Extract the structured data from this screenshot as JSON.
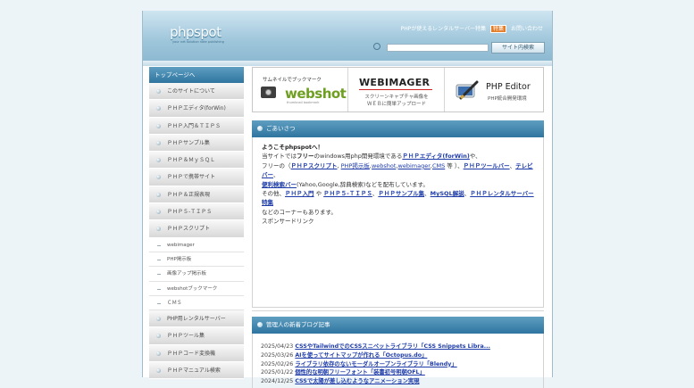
{
  "header": {
    "logo": "phpspot",
    "logo_sub": "your net solution note publishing",
    "links": [
      {
        "label": "PHPが使えるレンタルサーバー特集"
      },
      {
        "label": "特集"
      },
      {
        "label": "お問い合わせ"
      }
    ],
    "search_button": "サイト内検索"
  },
  "sidebar": {
    "title": "トップページへ",
    "items": [
      {
        "label": "このサイトについて"
      },
      {
        "label": "ＰＨＰエディタ(forWin)"
      },
      {
        "label": "ＰＨＰ入門＆ＴＩＰＳ"
      },
      {
        "label": "ＰＨＰサンプル集"
      },
      {
        "label": "ＰＨＰ＆ＭｙＳＱＬ"
      },
      {
        "label": "ＰＨＰで携帯サイト"
      },
      {
        "label": "ＰＨＰ＆正規表現"
      },
      {
        "label": "ＰＨＰ５-ＴＩＰＳ"
      },
      {
        "label": "ＰＨＰスクリプト"
      }
    ],
    "subitems": [
      {
        "label": "webimager"
      },
      {
        "label": "PHP掲示板"
      },
      {
        "label": "画像アップ掲示板"
      },
      {
        "label": "webshotブックマーク"
      },
      {
        "label": "ＣＭＳ"
      }
    ],
    "items2": [
      {
        "label": "PHP用レンタルサーバー"
      },
      {
        "label": "ＰＨＰツール集"
      },
      {
        "label": "ＰＨＰコード変換機"
      },
      {
        "label": "ＰＨＰマニュアル検索"
      }
    ]
  },
  "banners": {
    "webshot": {
      "title": "サムネイルでブックマーク",
      "brand": "webshot",
      "sub": "thumbnail bookmark"
    },
    "webimager": {
      "brand": "WEBIMAGER",
      "line1": "スクリーンキャプチャ画像を",
      "line2": "ＷＥＢに簡単アップロード"
    },
    "editor": {
      "brand": "PHP Editor",
      "sub": "PHP統合開発環境"
    }
  },
  "greeting": {
    "title": "ごあいさつ",
    "welcome": "ようこそphpspotへ！",
    "line1_a": "当サイトでは",
    "line1_b": "フリー",
    "line1_c": "のwindows用php開発環境である",
    "editor_link": "ＰＨＰエディタ(forWin)",
    "line1_d": "や、",
    "line2_a": "フリーの",
    "links2": [
      {
        "label": "ＰＨＰスクリプト"
      },
      {
        "label": "PHP掲示板"
      },
      {
        "label": "webshot"
      },
      {
        "label": "webimager"
      },
      {
        "label": "CMS"
      }
    ],
    "line2_etc": " 等 ）、",
    "tools_link": "ＰＨＰツールバー",
    "tele_link": "テレビバー",
    "search_link": "便利検索バー",
    "line3_b": "(Yahoo,Google,辞典検索)などを配布しています。",
    "line4_a": "その他、",
    "links4": [
      {
        "label": "ＰＨＰ入門"
      },
      {
        "label": "ＰＨＰ５-ＴＩＰＳ"
      },
      {
        "label": "ＰＨＰサンプル集"
      },
      {
        "label": "MySQL解説"
      },
      {
        "label": "ＰＨＰレンタルサーバー特集"
      }
    ],
    "line5": "などのコーナーもあります。",
    "sponsored": "スポンサードリンク"
  },
  "blog": {
    "title": "管理人の新着ブログ記事",
    "posts": [
      {
        "date": "2025/04/23",
        "title": "CSSやTailwindでのCSSスニペットライブラリ「CSS Snippets Libra..."
      },
      {
        "date": "2025/03/26",
        "title": "AIを使ってサイトマップが作れる「Octopus.do」"
      },
      {
        "date": "2025/02/26",
        "title": "ライブラリ依存のないモーダルオープンライブラリ「Blendy」"
      },
      {
        "date": "2025/01/22",
        "title": "個性的な明朝フリーフォント「装書初号明朝OFL」"
      },
      {
        "date": "2024/12/25",
        "title": "CSSで太陽が差し込むようなアニメーション実現"
      }
    ]
  },
  "colors": {
    "accent": "#2f75a0",
    "link": "#1d3ba8",
    "webshot_green": "#6f9f21",
    "tag_orange": "#e47d2a"
  }
}
